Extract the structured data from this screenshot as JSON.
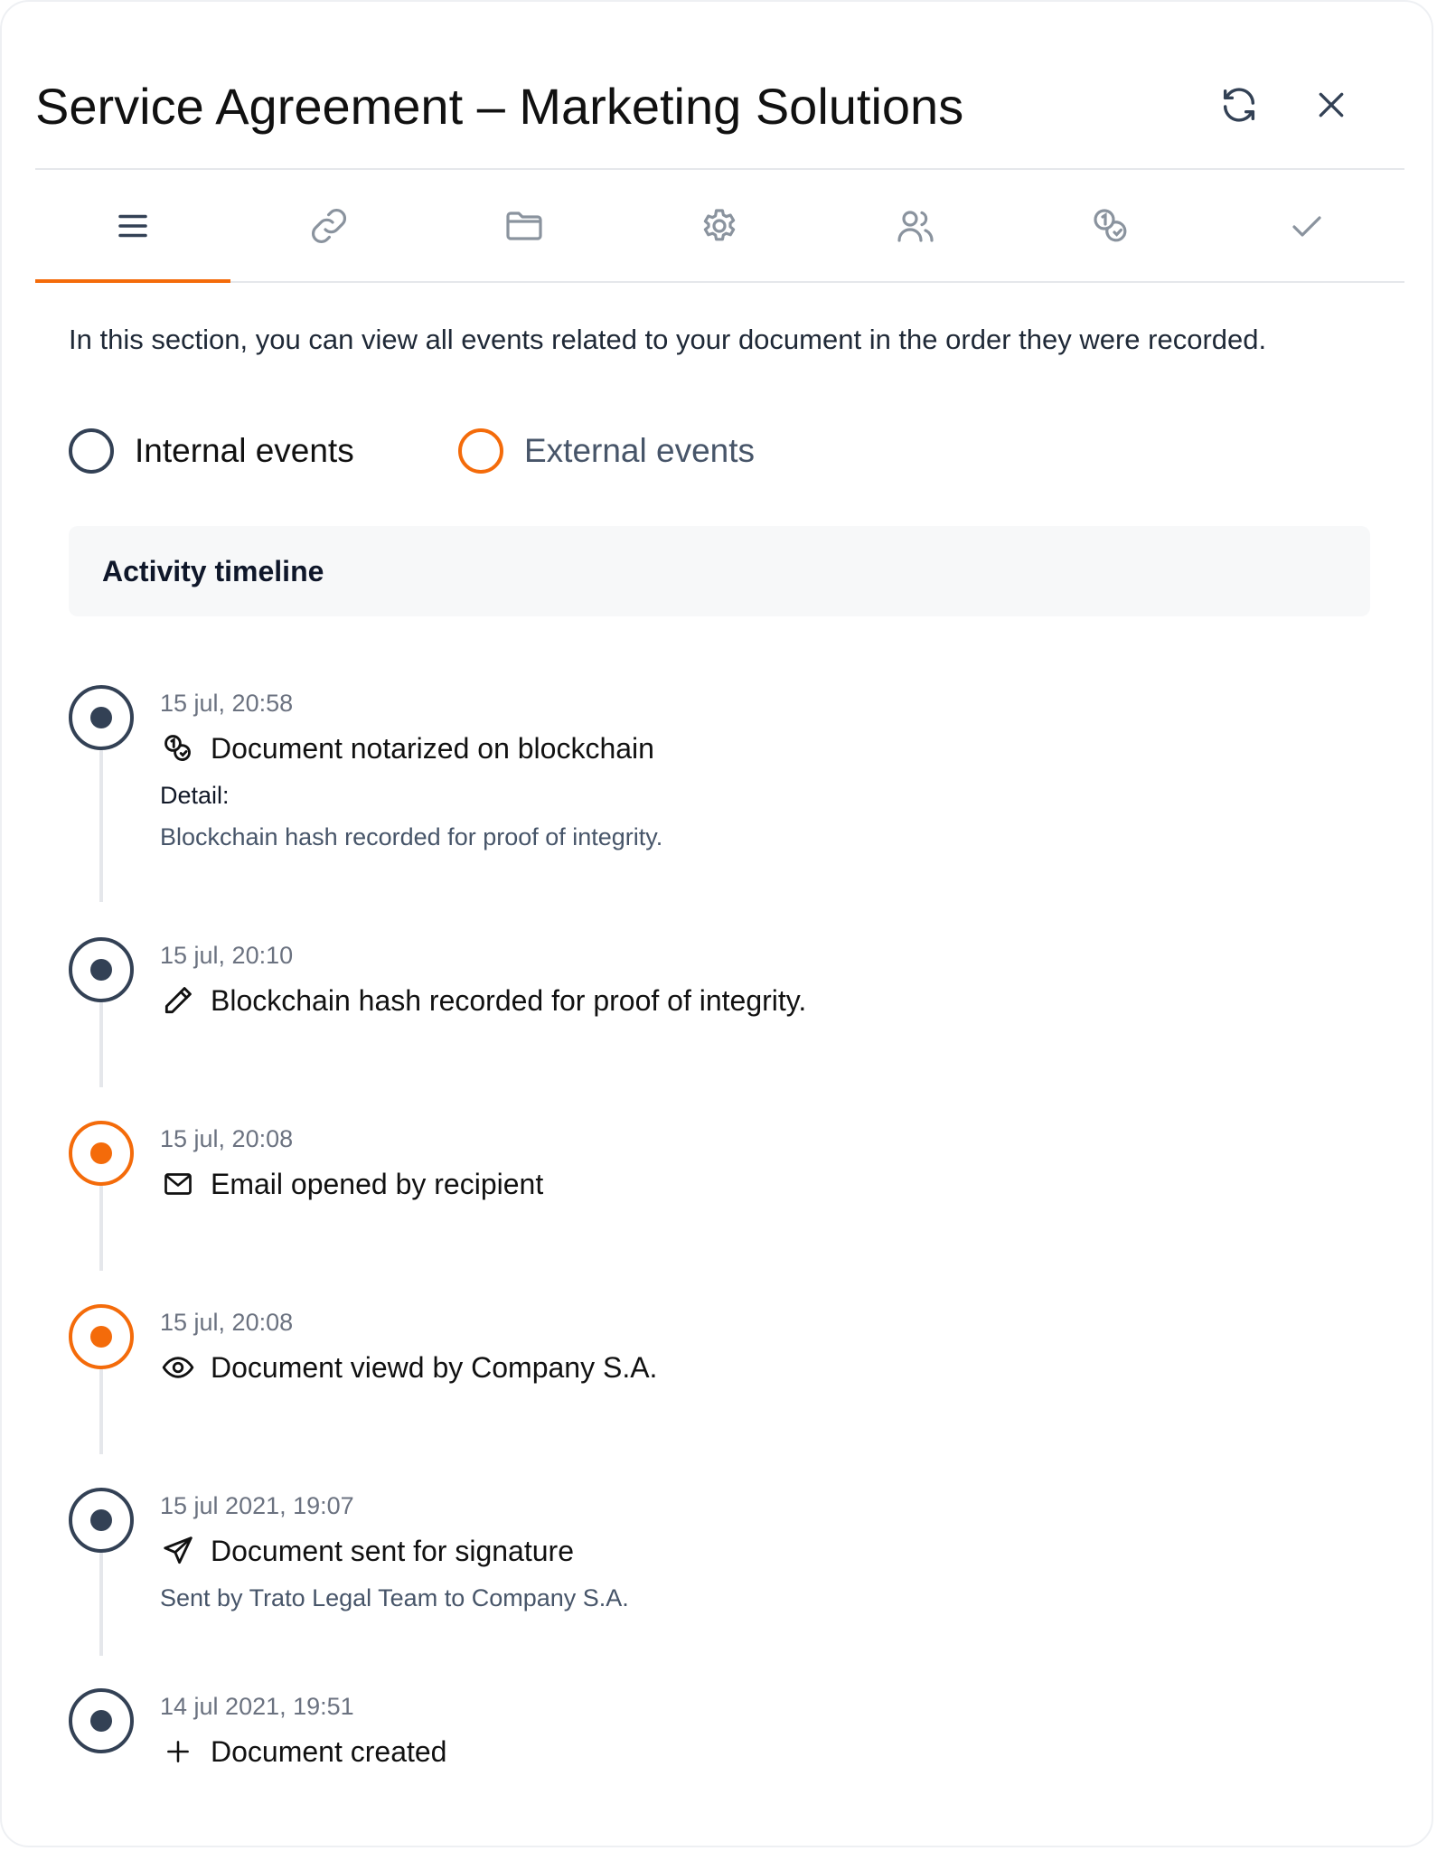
{
  "header": {
    "title": "Service Agreement – Marketing Solutions",
    "refresh_icon": "refresh-icon",
    "close_icon": "close-icon"
  },
  "tabs": [
    {
      "icon": "list-icon",
      "active": true
    },
    {
      "icon": "link-icon",
      "active": false
    },
    {
      "icon": "folder-icon",
      "active": false
    },
    {
      "icon": "gear-icon",
      "active": false
    },
    {
      "icon": "users-icon",
      "active": false
    },
    {
      "icon": "blockchain-icon",
      "active": false
    },
    {
      "icon": "check-icon",
      "active": false
    }
  ],
  "intro": "In this section, you can view all events related to your document in the order they were recorded.",
  "filters": {
    "internal": {
      "label": "Internal events",
      "color": "#334155"
    },
    "external": {
      "label": "External events",
      "color": "#f46b0a"
    }
  },
  "timeline": {
    "title": "Activity timeline",
    "events": [
      {
        "time": "15 jul, 20:58",
        "icon": "blockchain-icon",
        "title": "Document notarized on blockchain",
        "detail_label": "Detail:",
        "note": "Blockchain hash recorded for proof of integrity.",
        "kind": "internal"
      },
      {
        "time": "15 jul, 20:10",
        "icon": "pencil-icon",
        "title": "Blockchain hash recorded for proof of integrity.",
        "kind": "internal"
      },
      {
        "time": "15 jul, 20:08",
        "icon": "mail-icon",
        "title": "Email opened by recipient",
        "kind": "external"
      },
      {
        "time": "15 jul, 20:08",
        "icon": "eye-icon",
        "title": "Document viewd by Company S.A.",
        "kind": "external"
      },
      {
        "time": "15 jul 2021, 19:07",
        "icon": "send-icon",
        "title": "Document sent for signature",
        "note": "Sent by Trato Legal Team to Company S.A.",
        "kind": "internal"
      },
      {
        "time": "14 jul 2021, 19:51",
        "icon": "plus-icon",
        "title": "Document created",
        "kind": "internal"
      }
    ]
  },
  "colors": {
    "accent": "#f46b0a",
    "internal": "#334155",
    "divider": "#e5e7eb"
  }
}
